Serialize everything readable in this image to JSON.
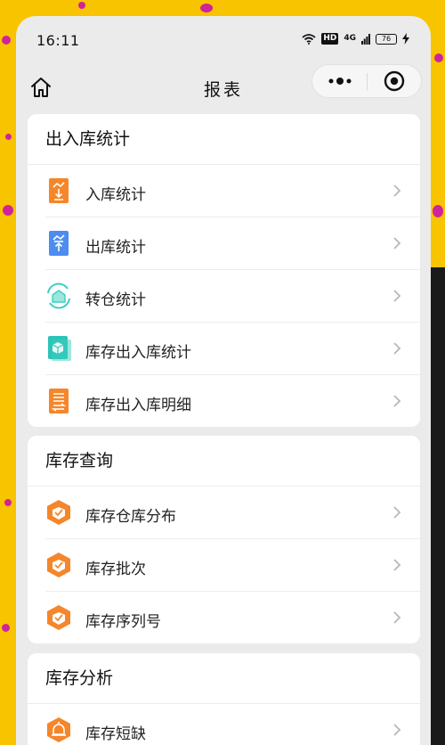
{
  "status_bar": {
    "time": "16:11",
    "hd": "HD",
    "network": "4G",
    "battery": "76"
  },
  "navbar": {
    "title": "报表"
  },
  "sections": [
    {
      "title": "出入库统计",
      "items": [
        {
          "label": "入库统计",
          "icon": "inbound-stats-icon"
        },
        {
          "label": "出库统计",
          "icon": "outbound-stats-icon"
        },
        {
          "label": "转仓统计",
          "icon": "transfer-stats-icon"
        },
        {
          "label": "库存出入库统计",
          "icon": "inventory-inout-stats-icon"
        },
        {
          "label": "库存出入库明细",
          "icon": "inventory-inout-detail-icon"
        }
      ]
    },
    {
      "title": "库存查询",
      "items": [
        {
          "label": "库存仓库分布",
          "icon": "warehouse-distribution-icon"
        },
        {
          "label": "库存批次",
          "icon": "inventory-batch-icon"
        },
        {
          "label": "库存序列号",
          "icon": "inventory-serial-icon"
        }
      ]
    },
    {
      "title": "库存分析",
      "items": [
        {
          "label": "库存短缺",
          "icon": "inventory-shortage-icon"
        }
      ]
    }
  ],
  "colors": {
    "orange": "#f5862a",
    "blue": "#4d8cf0",
    "teal": "#3ccdc0",
    "background": "#ebebeb",
    "wallpaper": "#f8c400"
  }
}
